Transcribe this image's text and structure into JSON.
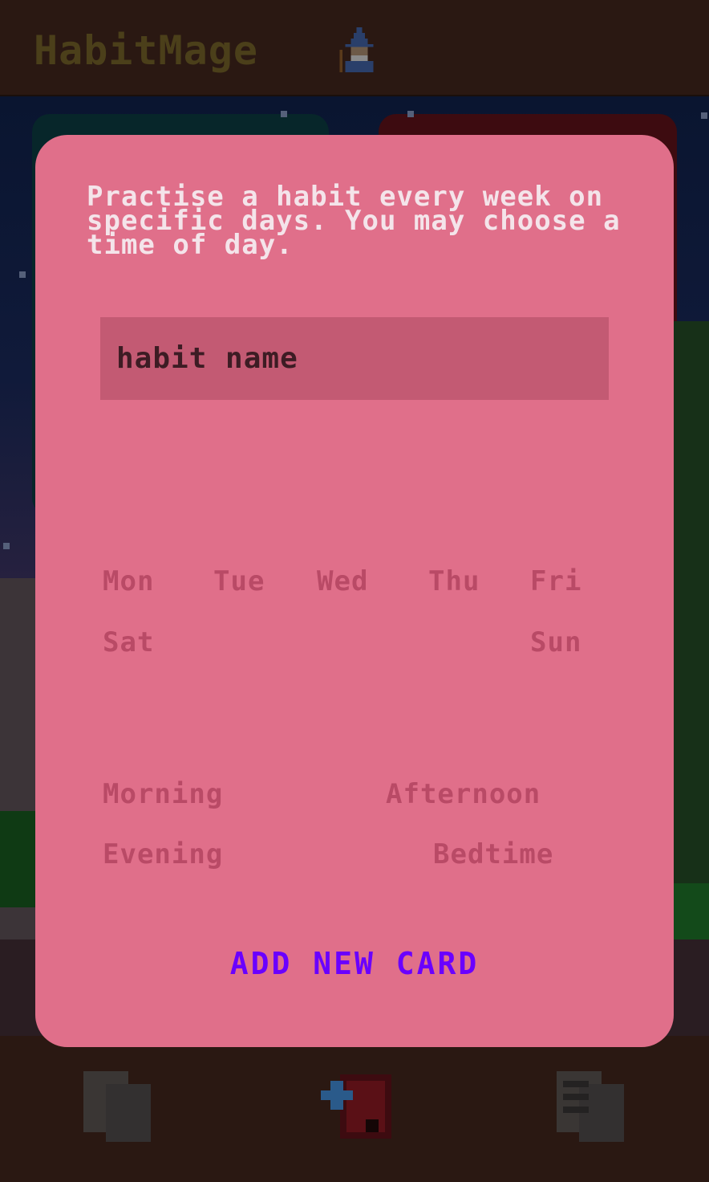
{
  "header": {
    "title": "HabitMage",
    "logo_icon": "wizard-icon"
  },
  "modal": {
    "description": "Practise a habit every week on specific days. You may choose a time of day.",
    "name_input": {
      "value": "",
      "placeholder": "habit name"
    },
    "days": [
      "Mon",
      "Tue",
      "Wed",
      "Thu",
      "Fri",
      "Sat",
      "Sun"
    ],
    "times": [
      "Morning",
      "Afternoon",
      "Evening",
      "Bedtime"
    ],
    "add_button": "ADD NEW CARD"
  },
  "footer": {
    "nav": [
      {
        "icon": "cards-icon"
      },
      {
        "icon": "add-card-icon"
      },
      {
        "icon": "list-cards-icon"
      }
    ]
  },
  "colors": {
    "modal_bg": "#e06f8a",
    "option_text": "#b94a66",
    "accent_button": "#6a00ff",
    "input_bg": "#c35a73"
  }
}
